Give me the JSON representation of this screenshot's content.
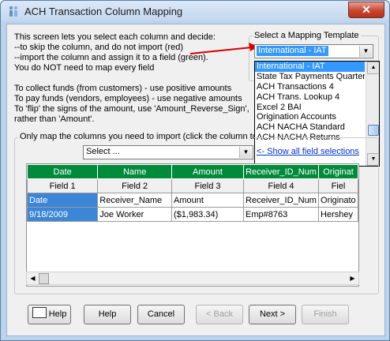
{
  "window": {
    "title": "ACH Transaction Column Mapping",
    "close_label": "✕"
  },
  "intro": {
    "lines": [
      "This screen lets you select each column and decide:",
      "--to skip the column, and do not import (red)",
      "--import the column and assign it to a field (green).",
      "You do NOT need to map every field",
      "",
      "To collect funds (from customers) - use positive amounts",
      "To pay funds (vendors, employees) - use negative amounts",
      "To 'flip' the signs of the amount, use 'Amount_Reverse_Sign',",
      "rather than 'Amount'."
    ]
  },
  "template": {
    "group_label": "Select a Mapping Template",
    "selected": "International - IAT",
    "options": [
      "International - IAT",
      "State Tax Payments Quarterly",
      "ACH Transactions 4",
      "ACH Trans. Lookup 4",
      "Excel 2 BAI",
      "Origination Accounts",
      "ACH NACHA Standard",
      "ACH NACHA Returns"
    ]
  },
  "mapping": {
    "group_label": "Only map the columns you need to import (click the column to s",
    "field_select": "Select ...",
    "show_all_link": "<- Show all field selections",
    "headers": [
      "Date",
      "Name",
      "Amount",
      "Receiver_ID_Num",
      "Originat"
    ],
    "fields": [
      "Field 1",
      "Field 2",
      "Field 3",
      "Field 4",
      "Fiel"
    ],
    "rows": [
      [
        "Date",
        "Receiver_Name",
        "Amount",
        "Receiver_ID_Num",
        "Originato"
      ],
      [
        "9/18/2009",
        "Joe Worker",
        "($1,983.34)",
        "Emp#8763",
        "Hershey"
      ]
    ]
  },
  "buttons": {
    "help_icon_label": "Help",
    "help": "Help",
    "cancel": "Cancel",
    "back": "< Back",
    "next": "Next >",
    "finish": "Finish"
  },
  "colors": {
    "header_green": "#008a3c",
    "highlight_blue": "#3c86d8",
    "arrow_red": "#d40000"
  }
}
